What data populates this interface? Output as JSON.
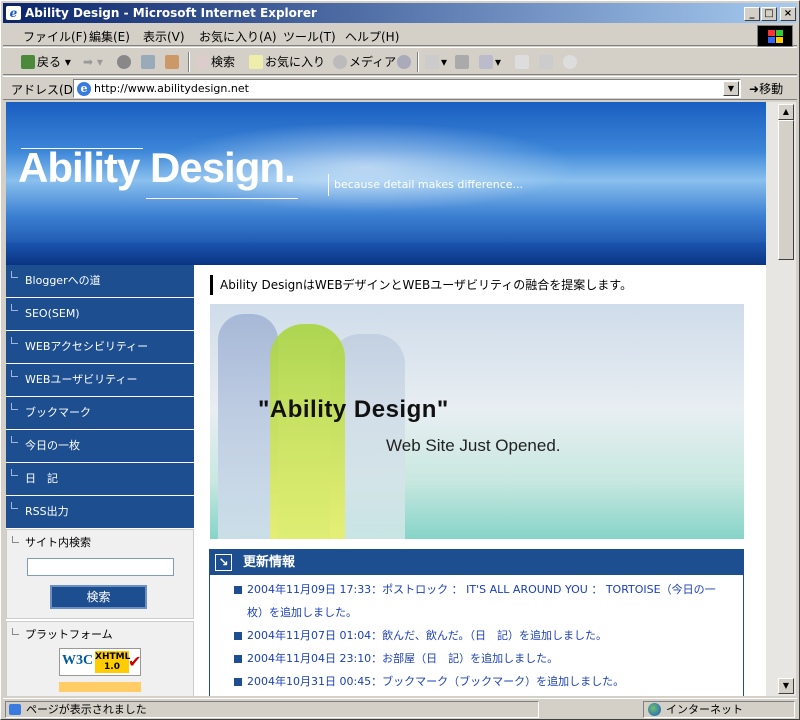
{
  "window": {
    "title": "Ability Design - Microsoft Internet Explorer"
  },
  "menu": [
    "ファイル(F)",
    "編集(E)",
    "表示(V)",
    "お気に入り(A)",
    "ツール(T)",
    "ヘルプ(H)"
  ],
  "toolbar": {
    "back": "戻る",
    "search": "検索",
    "favorites": "お気に入り",
    "media": "メディア"
  },
  "address": {
    "label": "アドレス(D)",
    "url": "http://www.abilitydesign.net",
    "go": "移動"
  },
  "banner": {
    "logo": "Ability Design.",
    "tagline": "because detail makes difference..."
  },
  "nav": [
    "Bloggerへの道",
    "SEO(SEM)",
    "WEBアクセシビリティー",
    "WEBユーザビリティー",
    "ブックマーク",
    "今日の一枚",
    "日　記",
    "RSS出力"
  ],
  "search": {
    "title": "サイト内検索",
    "button": "検索",
    "value": ""
  },
  "platform": {
    "title": "プラットフォーム",
    "badge_w3c": "W3C",
    "badge_xhtml": "XHTML",
    "badge_version": "1.0"
  },
  "intro": "Ability DesignはWEBデザインとWEBユーザビリティの融合を提案します。",
  "hero": {
    "title": "\"Ability Design\"",
    "subtitle": "Web Site Just Opened."
  },
  "news": {
    "title": "更新情報",
    "items": [
      "2004年11月09日 17:33：ポストロック ： IT'S ALL AROUND YOU ： TORTOISE（今日の一枚）を追加しました。",
      "2004年11月07日 01:04：飲んだ、飲んだ。（日　記）を追加しました。",
      "2004年11月04日 23:10：お部屋（日　記）を追加しました。",
      "2004年10月31日 00:45：ブックマーク（ブックマーク）を追加しました。"
    ]
  },
  "status": {
    "text": "ページが表示されました",
    "zone": "インターネット"
  }
}
